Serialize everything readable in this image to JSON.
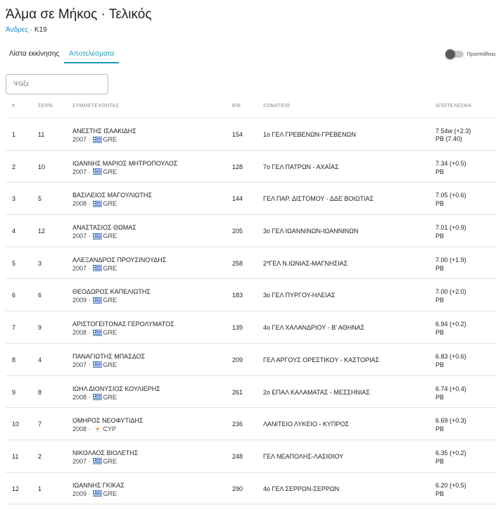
{
  "header": {
    "title": "Άλμα σε Μήκος · Τελικός",
    "category_link": "Άνδρες",
    "category_sep": " · ",
    "category_age": "K19"
  },
  "tabs": [
    {
      "label": "Λίστα εκκίνησης",
      "active": false
    },
    {
      "label": "Αποτελέσματα",
      "active": true
    }
  ],
  "toggle": {
    "label": "Προσπάθειες",
    "on": false
  },
  "search": {
    "placeholder": "Ψάξε",
    "value": ""
  },
  "table": {
    "columns": {
      "pos": "#",
      "order": "ΣΕΙΡΑ",
      "athlete": "ΣΥΜΜΕΤΕΧΟΝΤΑΣ",
      "bib": "BIB",
      "club": "ΣΩΜΑΤΕΙΟ",
      "result": "ΑΠΟΤΕΛΕΣΜΑ"
    },
    "rows": [
      {
        "pos": "1",
        "order": "11",
        "name": "ΑΝΕΣΤΗΣ ΙΣΑΑΚΙΔΗΣ",
        "year": "2007",
        "country": "GRE",
        "bib": "154",
        "club": "1ο ΓΕΛ ΓΡΕΒΕΝΩΝ-ΓΡΕΒΕΝΩΝ",
        "result": "7.54w (+2.3)",
        "note": "PB (7.40)"
      },
      {
        "pos": "2",
        "order": "10",
        "name": "ΙΩΑΝΝΗΣ ΜΑΡΙΟΣ ΜΗΤΡΟΠΟΥΛΟΣ",
        "year": "2007",
        "country": "GRE",
        "bib": "128",
        "club": "7ο ΓΕΛ ΠΑΤΡΩΝ - ΑΧΑΪΑΣ",
        "result": "7.34 (+0.5)",
        "note": "PB"
      },
      {
        "pos": "3",
        "order": "5",
        "name": "ΒΑΣΙΛΕΙΟΣ ΜΑΓΟΥΛΙΩΤΗΣ",
        "year": "2008",
        "country": "GRE",
        "bib": "144",
        "club": "ΓΕΛ ΠΑΡ. ΔΙΣΤΟΜΟΥ - ΔΔΕ ΒΟΙΩΤΙΑΣ",
        "result": "7.05 (+0.6)",
        "note": "PB"
      },
      {
        "pos": "4",
        "order": "12",
        "name": "ΑΝΑΣΤΑΣΙΟΣ ΘΩΜΑΣ",
        "year": "2007",
        "country": "GRE",
        "bib": "205",
        "club": "3ο ΓΕΛ ΙΩΑΝΝΙΝΩΝ-ΙΩΑΝΝΙΝΩΝ",
        "result": "7.01 (+0.9)",
        "note": "PB"
      },
      {
        "pos": "5",
        "order": "3",
        "name": "ΑΛΕΞΑΝΔΡΟΣ ΠΡΟΥΣΙΝΟΥΔΗΣ",
        "year": "2007",
        "country": "GRE",
        "bib": "258",
        "club": "2ºΓΕΛ Ν.ΙΩΝΙΑΣ-ΜΑΓΝΗΣΙΑΣ",
        "result": "7.00 (+1.9)",
        "note": "PB"
      },
      {
        "pos": "6",
        "order": "6",
        "name": "ΘΕΟΔΩΡΟΣ ΚΑΠΕΛΙΩΤΗΣ",
        "year": "2009",
        "country": "GRE",
        "bib": "183",
        "club": "3ο ΓΕΛ ΠΥΡΓΟΥ-ΗΛΕΙΑΣ",
        "result": "7.00 (+2.0)",
        "note": "PB"
      },
      {
        "pos": "7",
        "order": "9",
        "name": "ΑΡΙΣΤΟΓΕΙΤΟΝΑΣ ΓΕΡΟΛΥΜΑΤΟΣ",
        "year": "2008",
        "country": "GRE",
        "bib": "139",
        "club": "4ο ΓΕΛ ΧΑΛΑΝΔΡΙΟΥ - Β' ΑΘΗΝΑΣ",
        "result": "6.94 (+0.2)",
        "note": "PB"
      },
      {
        "pos": "8",
        "order": "4",
        "name": "ΠΑΝΑΓΙΩΤΗΣ ΜΠΑΣΔΟΣ",
        "year": "2007",
        "country": "GRE",
        "bib": "209",
        "club": "ΓΕΛ ΑΡΓΟΥΣ ΟΡΕΣΤΙΚΟΥ - ΚΑΣΤΟΡΙΑΣ",
        "result": "6.83 (+0.6)",
        "note": "PB"
      },
      {
        "pos": "9",
        "order": "8",
        "name": "ΙΩΗΛ ΔΙΟΝΥΣΙΟΣ ΚΟΥΛΙΕΡΗΣ",
        "year": "2008",
        "country": "GRE",
        "bib": "261",
        "club": "2ο ΕΠΑΛ ΚΑΛΑΜΑΤΑΣ - ΜΕΣΣΗΝΙΑΣ",
        "result": "6.74 (+0.4)",
        "note": "PB"
      },
      {
        "pos": "10",
        "order": "7",
        "name": "ΟΜΗΡΟΣ ΝΕΟΦΥΤΙΔΗΣ",
        "year": "2008",
        "country": "CYP",
        "bib": "236",
        "club": "ΛΑΝΙΤΕΙΟ ΛΥΚΕΙΟ - ΚΥΠΡΟΣ",
        "result": "6.69 (+0.3)",
        "note": "PB"
      },
      {
        "pos": "11",
        "order": "2",
        "name": "ΝΙΚΟΛΑΟΣ ΒΙΟΛΕΤΗΣ",
        "year": "2007",
        "country": "GRE",
        "bib": "248",
        "club": "ΓΕΛ ΝΕΑΠΟΛΗΣ-ΛΑΣΙΘΙΟΥ",
        "result": "6.35 (+0.2)",
        "note": "PB"
      },
      {
        "pos": "12",
        "order": "1",
        "name": "ΙΩΑΝΝΗΣ ΓΚΙΚΑΣ",
        "year": "2009",
        "country": "GRE",
        "bib": "290",
        "club": "4ο ΓΕΛ ΣΕΡΡΩΝ-ΣΕΡΡΩΝ",
        "result": "6.20 (+0.5)",
        "note": "PB"
      }
    ]
  },
  "colors": {
    "accent": "#1e9bb8",
    "link": "#1e88c8",
    "greek_flag_blue": "#1f5cb5",
    "cyprus_copper": "#d57800"
  },
  "icons": {
    "GRE": "greece-flag-icon",
    "CYP": "cyprus-flag-icon"
  }
}
